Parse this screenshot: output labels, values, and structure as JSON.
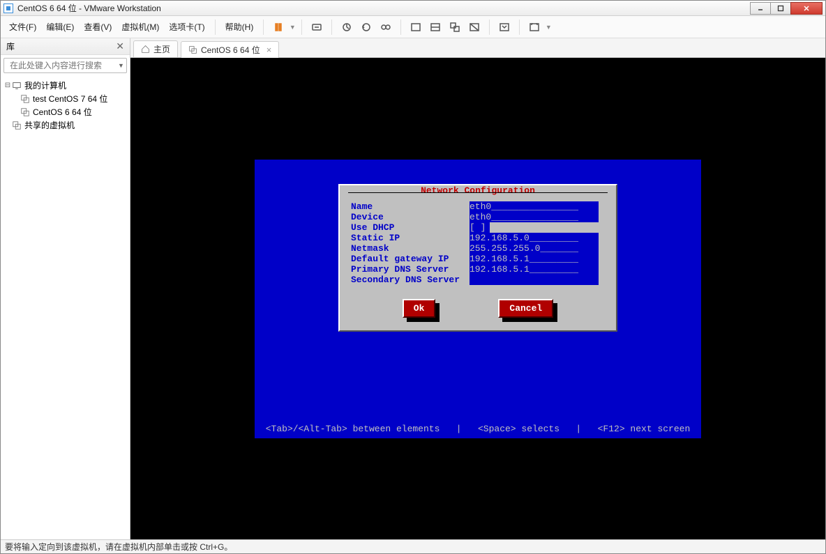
{
  "window": {
    "title": "CentOS 6 64 位 - VMware Workstation"
  },
  "menu": {
    "file": "文件(F)",
    "edit": "编辑(E)",
    "view": "查看(V)",
    "vm": "虚拟机(M)",
    "tabs": "选项卡(T)",
    "help": "帮助(H)"
  },
  "sidebar": {
    "title": "库",
    "search_placeholder": "在此处键入内容进行搜索",
    "nodes": {
      "root": "我的计算机",
      "vm1": "test CentOS 7 64 位",
      "vm2": "CentOS 6 64 位",
      "shared": "共享的虚拟机"
    }
  },
  "tabs": {
    "home": "主页",
    "vm": "CentOS 6 64 位"
  },
  "dialog": {
    "title": "Network Configuration",
    "labels": {
      "name": "Name",
      "device": "Device",
      "dhcp": "Use DHCP",
      "ip": "Static IP",
      "mask": "Netmask",
      "gw": "Default gateway IP",
      "dns1": "Primary DNS Server",
      "dns2": "Secondary DNS Server"
    },
    "values": {
      "name": "eth0________________",
      "device": "eth0________________",
      "dhcp": "[ ]",
      "ip": "192.168.5.0_________",
      "mask": "255.255.255.0_______",
      "gw": "192.168.5.1_________",
      "dns1": "192.168.5.1_________",
      "dns2": "                    "
    },
    "ok": "Ok",
    "cancel": "Cancel"
  },
  "hint": "<Tab>/<Alt-Tab> between elements   |   <Space> selects   |   <F12> next screen",
  "status": "要将输入定向到该虚拟机，请在虚拟机内部单击或按 Ctrl+G。"
}
